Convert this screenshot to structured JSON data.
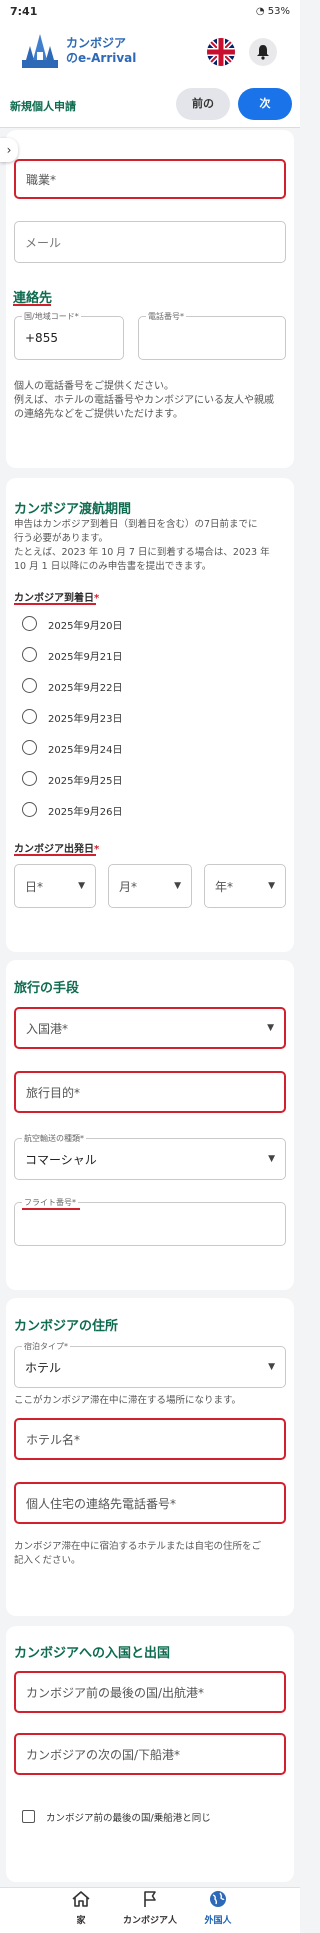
{
  "status_bar": {
    "time": "7:41",
    "battery": "53%"
  },
  "header": {
    "logo_line1": "カンボジア",
    "logo_line2": "のe-Arrival",
    "flag_icon": "uk-flag-icon",
    "bell_icon": "bell-icon"
  },
  "subbar": {
    "title": "新規個人申請",
    "prev_label": "前の",
    "next_label": "次"
  },
  "personal": {
    "occupation_label": "職業*",
    "email_placeholder": "メール"
  },
  "contact": {
    "title": "連絡先",
    "country_code_label": "国/地域コード*",
    "country_code_value": "+855",
    "phone_label": "電話番号*",
    "help_line1": "個人の電話番号をご提供ください。",
    "help_line2": "例えば、ホテルの電話番号やカンボジアにいる友人や親戚",
    "help_line3": "の連絡先などをご提供いただけます。"
  },
  "travel_period": {
    "title": "カンボジア渡航期間",
    "help_line1": "申告はカンボジア到着日（到着日を含む）の7日前までに",
    "help_line2": "行う必要があります。",
    "help_line3": "たとえば、2023 年 10 月 7 日に到着する場合は、2023 年",
    "help_line4": "10 月 1 日以降にのみ申告書を提出できます。",
    "arrival_label": "カンボジア到着日",
    "arrival_dates": [
      "2025年9月20日",
      "2025年9月21日",
      "2025年9月22日",
      "2025年9月23日",
      "2025年9月24日",
      "2025年9月25日",
      "2025年9月26日"
    ],
    "departure_label": "カンボジア出発日",
    "day_label": "日*",
    "month_label": "月*",
    "year_label": "年*"
  },
  "travel_means": {
    "title": "旅行の手段",
    "port_label": "入国港*",
    "purpose_label": "旅行目的*",
    "transport_type_label": "航空輸送の種類*",
    "transport_type_value": "コマーシャル",
    "flight_label": "フライト番号*"
  },
  "address": {
    "title": "カンボジアの住所",
    "accommodation_type_label": "宿泊タイプ*",
    "accommodation_type_value": "ホテル",
    "stay_help": "ここがカンボジア滞在中に滞在する場所になります。",
    "hotel_name_label": "ホテル名*",
    "hotel_phone_label": "個人住宅の連絡先電話番号*",
    "address_help_line1": "カンボジア滞在中に宿泊するホテルまたは自宅の住所をご",
    "address_help_line2": "記入ください。"
  },
  "entry_exit": {
    "title": "カンボジアへの入国と出国",
    "last_port_label": "カンボジア前の最後の国/出航港*",
    "next_port_label": "カンボジアの次の国/下船港*",
    "same_as_label": "カンボジア前の最後の国/乗船港と同じ"
  },
  "bottom_nav": {
    "home_label": "家",
    "cambodian_label": "カンボジア人",
    "foreigner_label": "外国人"
  },
  "colors": {
    "accent_green": "#0e6b4f",
    "primary_blue": "#1a73e8",
    "highlight_red": "#d1212f"
  }
}
